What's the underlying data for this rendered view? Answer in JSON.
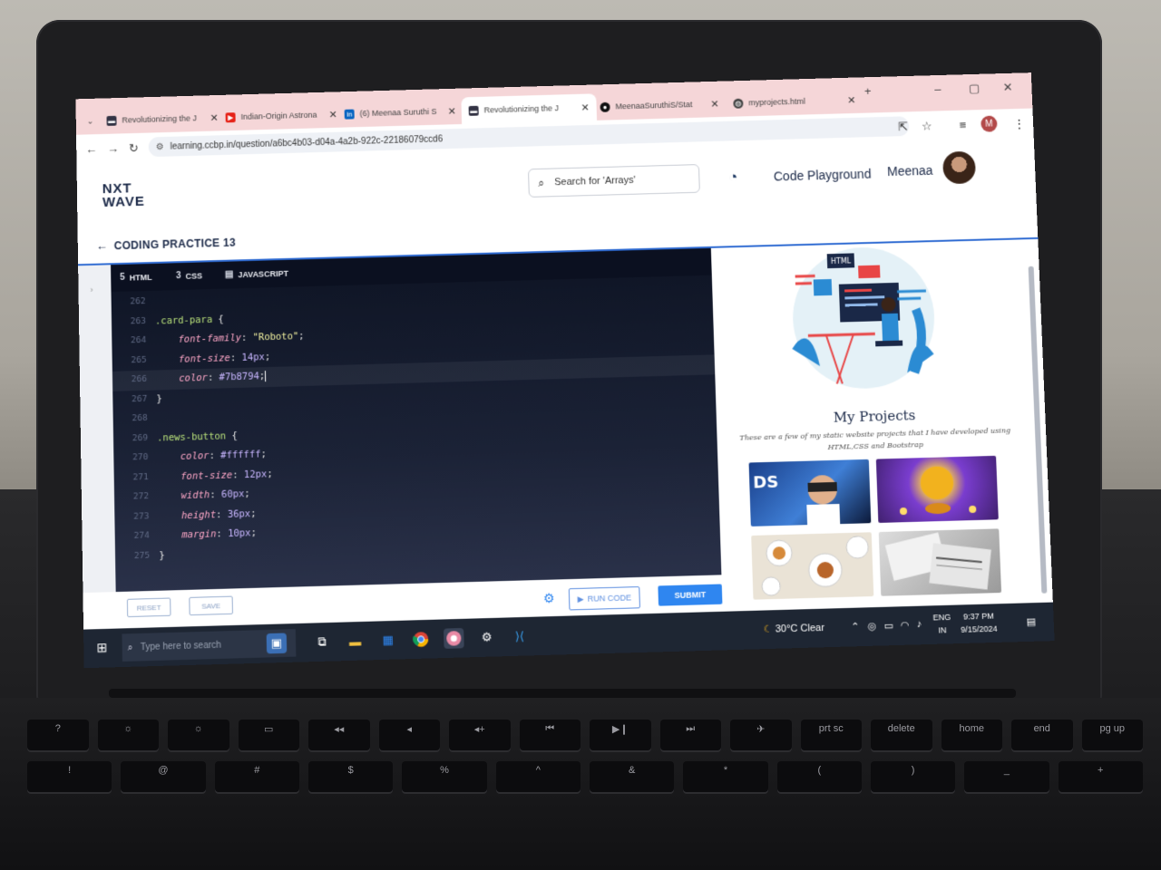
{
  "browser": {
    "tabs": [
      {
        "label": "Revolutionizing the J",
        "icon": "ccbp-icon"
      },
      {
        "label": "Indian-Origin Astrona",
        "icon": "youtube-icon"
      },
      {
        "label": "(6) Meenaa Suruthi S",
        "icon": "linkedin-icon"
      },
      {
        "label": "Revolutionizing the J",
        "icon": "ccbp-icon",
        "active": true
      },
      {
        "label": "MeenaaSuruthiS/Stat",
        "icon": "github-icon"
      },
      {
        "label": "myprojects.html",
        "icon": "globe-icon"
      }
    ],
    "url": "learning.ccbp.in/question/a6bc4b03-d04a-4a2b-922c-22186079ccd6",
    "profile_initial": "M"
  },
  "app": {
    "logo_line1": "NXT",
    "logo_line2": "WAVE",
    "search_placeholder": "Search for 'Arrays'",
    "nav_code_playground": "Code Playground",
    "user_name": "Meenaa",
    "breadcrumb_title": "CODING PRACTICE 13"
  },
  "editor": {
    "tabs": [
      "HTML",
      "CSS",
      "JAVASCRIPT"
    ],
    "lines": [
      {
        "n": "262",
        "parts": []
      },
      {
        "n": "263",
        "parts": [
          {
            "t": ".card-para",
            "c": "sel"
          },
          {
            "t": " {",
            "c": "punc"
          }
        ]
      },
      {
        "n": "264",
        "parts": [
          {
            "t": "    font-family",
            "c": "prop"
          },
          {
            "t": ": ",
            "c": "punc"
          },
          {
            "t": "\"Roboto\"",
            "c": "str"
          },
          {
            "t": ";",
            "c": "punc"
          }
        ]
      },
      {
        "n": "265",
        "parts": [
          {
            "t": "    font-size",
            "c": "prop"
          },
          {
            "t": ": ",
            "c": "punc"
          },
          {
            "t": "14px",
            "c": "val"
          },
          {
            "t": ";",
            "c": "punc"
          }
        ]
      },
      {
        "n": "266",
        "parts": [
          {
            "t": "    color",
            "c": "prop"
          },
          {
            "t": ": ",
            "c": "punc"
          },
          {
            "t": "#7b8794",
            "c": "val"
          },
          {
            "t": ";",
            "c": "punc"
          }
        ],
        "active": true
      },
      {
        "n": "267",
        "parts": [
          {
            "t": "}",
            "c": "punc"
          }
        ]
      },
      {
        "n": "268",
        "parts": []
      },
      {
        "n": "269",
        "parts": [
          {
            "t": ".news-button",
            "c": "sel"
          },
          {
            "t": " {",
            "c": "punc"
          }
        ]
      },
      {
        "n": "270",
        "parts": [
          {
            "t": "    color",
            "c": "prop"
          },
          {
            "t": ": ",
            "c": "punc"
          },
          {
            "t": "#ffffff",
            "c": "val"
          },
          {
            "t": ";",
            "c": "punc"
          }
        ]
      },
      {
        "n": "271",
        "parts": [
          {
            "t": "    font-size",
            "c": "prop"
          },
          {
            "t": ": ",
            "c": "punc"
          },
          {
            "t": "12px",
            "c": "val"
          },
          {
            "t": ";",
            "c": "punc"
          }
        ]
      },
      {
        "n": "272",
        "parts": [
          {
            "t": "    width",
            "c": "prop"
          },
          {
            "t": ": ",
            "c": "punc"
          },
          {
            "t": "60px",
            "c": "val"
          },
          {
            "t": ";",
            "c": "punc"
          }
        ]
      },
      {
        "n": "273",
        "parts": [
          {
            "t": "    height",
            "c": "prop"
          },
          {
            "t": ": ",
            "c": "punc"
          },
          {
            "t": "36px",
            "c": "val"
          },
          {
            "t": ";",
            "c": "punc"
          }
        ]
      },
      {
        "n": "274",
        "parts": [
          {
            "t": "    margin",
            "c": "prop"
          },
          {
            "t": ": ",
            "c": "punc"
          },
          {
            "t": "10px",
            "c": "val"
          },
          {
            "t": ";",
            "c": "punc"
          }
        ]
      },
      {
        "n": "275",
        "parts": [
          {
            "t": "}",
            "c": "punc"
          }
        ]
      }
    ],
    "reset_label": "RESET",
    "save_label": "SAVE",
    "run_label": "RUN CODE",
    "submit_label": "SUBMIT"
  },
  "preview": {
    "badge_html": "HTML",
    "title": "My Projects",
    "description": "These are a few of my static website projects that I have developed using HTML,CSS and Bootstrap"
  },
  "taskbar": {
    "search_placeholder": "Type here to search",
    "weather": "30°C  Clear",
    "lang_line1": "ENG",
    "lang_line2": "IN",
    "time": "9:37 PM",
    "date": "9/15/2024"
  },
  "colors": {
    "accent": "#2f86f0",
    "tabbar": "#f5d6d8",
    "editor_bg": "#0e1424",
    "brand": "#1a2847"
  }
}
